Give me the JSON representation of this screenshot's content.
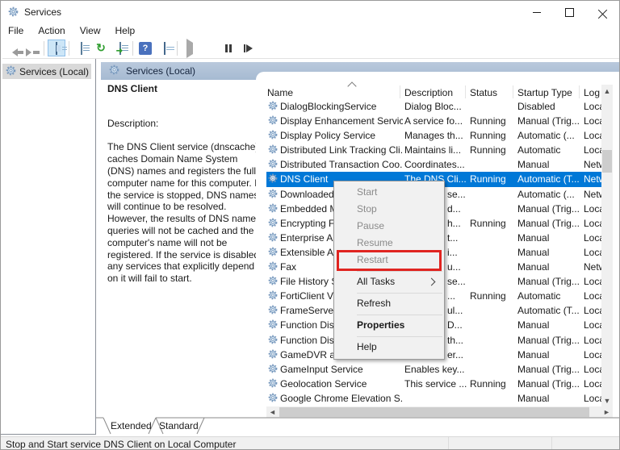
{
  "window": {
    "title": "Services"
  },
  "menu_bar": [
    "File",
    "Action",
    "View",
    "Help"
  ],
  "toolbar": {
    "icons": [
      "back-icon",
      "forward-icon",
      "sep",
      "console-tree-icon",
      "sep",
      "list-doc-icon",
      "refresh-icon",
      "export-list-icon",
      "sep",
      "help-icon",
      "properties-window-icon",
      "sep",
      "start-service-icon",
      "stop-service-icon",
      "pause-service-icon",
      "restart-service-icon"
    ],
    "active_icon": "console-tree-icon"
  },
  "tree": {
    "root_label": "Services (Local)"
  },
  "main": {
    "header": "Services (Local)",
    "detail": {
      "service_name": "DNS Client",
      "description_label": "Description:",
      "description": "The DNS Client service (dnscache) caches Domain Name System (DNS) names and registers the full computer name for this computer. If the service is stopped, DNS names will continue to be resolved. However, the results of DNS name queries will not be cached and the computer's name will not be registered. If the service is disabled, any services that explicitly depend on it will fail to start."
    },
    "table": {
      "columns": [
        "Name",
        "Description",
        "Status",
        "Startup Type",
        "Log"
      ],
      "rows": [
        {
          "name": "DialogBlockingService",
          "desc": "Dialog Bloc...",
          "status": "",
          "startup": "Disabled",
          "logon": "Loca"
        },
        {
          "name": "Display Enhancement Service",
          "desc": "A service fo...",
          "status": "Running",
          "startup": "Manual (Trig...",
          "logon": "Loca"
        },
        {
          "name": "Display Policy Service",
          "desc": "Manages th...",
          "status": "Running",
          "startup": "Automatic (...",
          "logon": "Loca"
        },
        {
          "name": "Distributed Link Tracking Cli...",
          "desc": "Maintains li...",
          "status": "Running",
          "startup": "Automatic",
          "logon": "Loca"
        },
        {
          "name": "Distributed Transaction Coo...",
          "desc": "Coordinates...",
          "status": "",
          "startup": "Manual",
          "logon": "Netw"
        },
        {
          "name": "DNS Client",
          "desc": "The DNS Cli...",
          "status": "Running",
          "startup": "Automatic (T...",
          "logon": "Netw",
          "selected": true
        },
        {
          "name": "Downloaded Maps Manager",
          "desc": "se...",
          "covered": true,
          "status": "",
          "startup": "Automatic (...",
          "logon": "Netw"
        },
        {
          "name": "Embedded Mode",
          "desc": "d...",
          "covered": true,
          "status": "",
          "startup": "Manual (Trig...",
          "logon": "Loca"
        },
        {
          "name": "Encrypting File System (EFS)",
          "desc": "h...",
          "covered": true,
          "status": "Running",
          "startup": "Manual (Trig...",
          "logon": "Loca"
        },
        {
          "name": "Enterprise App Management Service",
          "desc": "t...",
          "covered": true,
          "status": "",
          "startup": "Manual",
          "logon": "Loca"
        },
        {
          "name": "Extensible Authentication Protocol",
          "desc": "i...",
          "covered": true,
          "status": "",
          "startup": "Manual",
          "logon": "Loca"
        },
        {
          "name": "Fax",
          "desc": "u...",
          "covered": true,
          "status": "",
          "startup": "Manual",
          "logon": "Netw"
        },
        {
          "name": "File History Service",
          "desc": "se...",
          "covered": true,
          "status": "",
          "startup": "Manual (Trig...",
          "logon": "Loca"
        },
        {
          "name": "FortiClient VPN Service",
          "desc": "...",
          "covered": true,
          "status": "Running",
          "startup": "Automatic",
          "logon": "Loca"
        },
        {
          "name": "FrameServer",
          "desc": "ul...",
          "covered": true,
          "status": "",
          "startup": "Automatic (T...",
          "logon": "Loca"
        },
        {
          "name": "Function Discovery Provider Host",
          "desc": "D...",
          "covered": true,
          "status": "",
          "startup": "Manual",
          "logon": "Loca"
        },
        {
          "name": "Function Discovery Resource Publication",
          "desc": "th...",
          "covered": true,
          "status": "",
          "startup": "Manual (Trig...",
          "logon": "Loca"
        },
        {
          "name": "GameDVR and Broadcast User Service",
          "desc": "er...",
          "covered": true,
          "status": "",
          "startup": "Manual",
          "logon": "Loca"
        },
        {
          "name": "GameInput Service",
          "desc": "Enables key...",
          "status": "",
          "startup": "Manual (Trig...",
          "logon": "Loca"
        },
        {
          "name": "Geolocation Service",
          "desc": "This service ...",
          "status": "Running",
          "startup": "Manual (Trig...",
          "logon": "Loca"
        },
        {
          "name": "Google Chrome Elevation S...",
          "desc": "",
          "status": "",
          "startup": "Manual",
          "logon": "Loca"
        }
      ]
    },
    "tabs": [
      {
        "label": "Extended",
        "active": true
      },
      {
        "label": "Standard",
        "active": false
      }
    ]
  },
  "context_menu": {
    "items": [
      {
        "label": "Start",
        "enabled": false
      },
      {
        "label": "Stop",
        "enabled": false
      },
      {
        "label": "Pause",
        "enabled": false
      },
      {
        "label": "Resume",
        "enabled": false
      },
      {
        "label": "Restart",
        "enabled": false,
        "annotated": true,
        "separator_after": true
      },
      {
        "label": "All Tasks",
        "enabled": true,
        "submenu": true,
        "separator_after": true
      },
      {
        "label": "Refresh",
        "enabled": true,
        "separator_after": true
      },
      {
        "label": "Properties",
        "enabled": true,
        "bold": true,
        "separator_after": true
      },
      {
        "label": "Help",
        "enabled": true
      }
    ]
  },
  "status_bar": {
    "text": "Stop and Start service DNS Client on Local Computer"
  },
  "colors": {
    "selection": "#0078d7",
    "annotation": "#e02420",
    "header_bar": "#aec0d6"
  }
}
